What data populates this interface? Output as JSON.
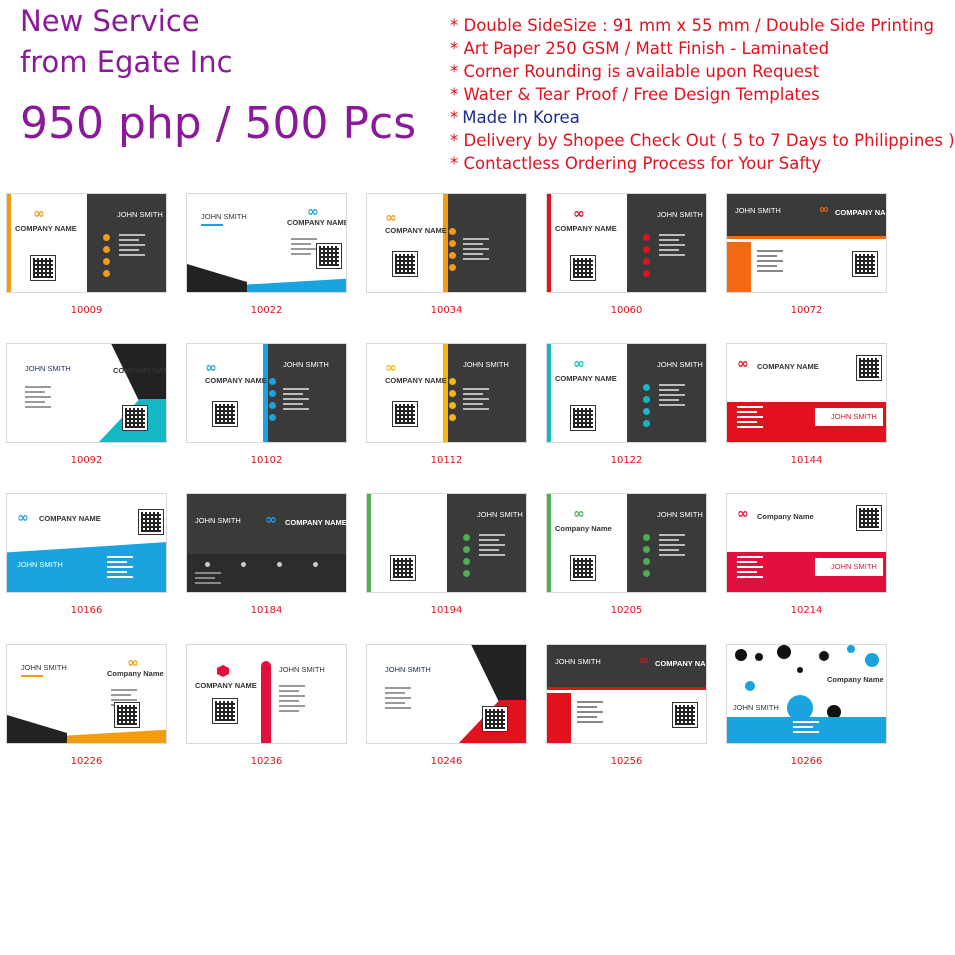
{
  "header": {
    "line1": "New Service",
    "line2": "from Egate Inc",
    "price": "950 php / 500 Pcs"
  },
  "features": [
    {
      "text": "* Double SideSize : 91 mm x 55 mm / Double Side Printing",
      "color": "#e3101d"
    },
    {
      "text": "* Art Paper 250 GSM / Matt Finish - Laminated",
      "color": "#e3101d"
    },
    {
      "text": "* Corner Rounding is available upon Request",
      "color": "#e3101d"
    },
    {
      "text": "* Water & Tear Proof / Free Design Templates",
      "color": "#e3101d"
    },
    {
      "text": "Made In Korea",
      "color": "#1a2c8c"
    },
    {
      "text": "* Delivery by Shopee Check Out ( 5 to 7 Days to Philippines )",
      "color": "#e3101d"
    },
    {
      "text": "* Contactless Ordering Process for Your Safty",
      "color": "#e3101d"
    }
  ],
  "cards": [
    {
      "code": "10009",
      "company": "COMPANY NAME",
      "person": "JOHN SMITH",
      "accent": "#f39c12",
      "dark": "#333333",
      "style": "split-left"
    },
    {
      "code": "10022",
      "company": "COMPANY NAME",
      "person": "JOHN SMITH",
      "accent": "#1aa3df",
      "dark": "#222222",
      "style": "white-wave"
    },
    {
      "code": "10034",
      "company": "COMPANY NAME",
      "person": "",
      "accent": "#f39c12",
      "dark": "#333333",
      "style": "split-right"
    },
    {
      "code": "10060",
      "company": "COMPANY NAME",
      "person": "JOHN SMITH",
      "accent": "#e3101d",
      "dark": "#333333",
      "style": "split-left"
    },
    {
      "code": "10072",
      "company": "COMPANY NAME",
      "person": "JOHN SMITH",
      "accent": "#f36a12",
      "dark": "#333333",
      "style": "top-dark"
    },
    {
      "code": "10092",
      "company": "COMPANY NAME",
      "person": "JOHN SMITH",
      "accent": "#14b8c4",
      "dark": "#222222",
      "style": "diagonal"
    },
    {
      "code": "10102",
      "company": "COMPANY NAME",
      "person": "JOHN SMITH",
      "accent": "#1aa3df",
      "dark": "#333333",
      "style": "split-right"
    },
    {
      "code": "10112",
      "company": "COMPANY NAME",
      "person": "JOHN SMITH",
      "accent": "#f3b712",
      "dark": "#333333",
      "style": "split-right"
    },
    {
      "code": "10122",
      "company": "COMPANY NAME",
      "person": "JOHN SMITH",
      "accent": "#14b8c4",
      "dark": "#333333",
      "style": "split-left"
    },
    {
      "code": "10144",
      "company": "COMPANY NAME",
      "person": "JOHN SMITH",
      "accent": "#e3101d",
      "dark": "#ffffff",
      "style": "bottom-red"
    },
    {
      "code": "10166",
      "company": "COMPANY NAME",
      "person": "JOHN SMITH",
      "accent": "#1aa3df",
      "dark": "#ffffff",
      "style": "bottom-blue"
    },
    {
      "code": "10184",
      "company": "COMPANY NAME",
      "person": "JOHN SMITH",
      "accent": "#1aa3df",
      "dark": "#333333",
      "style": "full-dark"
    },
    {
      "code": "10194",
      "company": "",
      "person": "JOHN SMITH",
      "accent": "#4caf50",
      "dark": "#333333",
      "style": "split-left"
    },
    {
      "code": "10205",
      "company": "Company Name",
      "person": "JOHN SMITH",
      "accent": "#4caf50",
      "dark": "#333333",
      "style": "split-left"
    },
    {
      "code": "10214",
      "company": "Company Name",
      "person": "JOHN SMITH",
      "accent": "#e3103d",
      "dark": "#ffffff",
      "style": "bottom-red"
    },
    {
      "code": "10226",
      "company": "Company Name",
      "person": "JOHN SMITH",
      "accent": "#f39c12",
      "dark": "#ffffff",
      "style": "white-wave"
    },
    {
      "code": "10236",
      "company": "COMPANY NAME",
      "person": "JOHN SMITH",
      "accent": "#e3103d",
      "dark": "#ffffff",
      "style": "white-plain"
    },
    {
      "code": "10246",
      "company": "COMPANY NAME",
      "person": "JOHN SMITH",
      "accent": "#e3101d",
      "dark": "#333333",
      "style": "diagonal"
    },
    {
      "code": "10256",
      "company": "COMPANY NAME",
      "person": "JOHN SMITH",
      "accent": "#e3101d",
      "dark": "#333333",
      "style": "top-dark"
    },
    {
      "code": "10266",
      "company": "Company Name",
      "person": "JOHN SMITH",
      "accent": "#1aa3df",
      "dark": "#ffffff",
      "style": "dots"
    }
  ]
}
